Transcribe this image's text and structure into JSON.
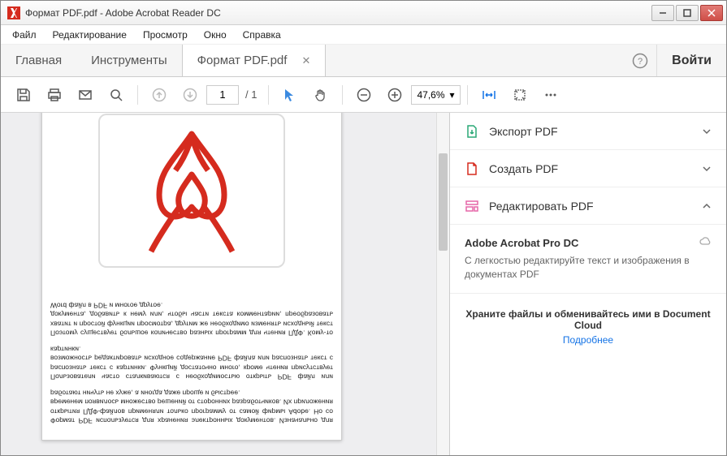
{
  "titlebar": {
    "title": "Формат PDF.pdf - Adobe Acrobat Reader DC"
  },
  "menu": {
    "file": "Файл",
    "edit": "Редактирование",
    "view": "Просмотр",
    "window": "Окно",
    "help": "Справка"
  },
  "tabs": {
    "home": "Главная",
    "tools": "Инструменты",
    "doc": "Формат PDF.pdf",
    "signin": "Войти"
  },
  "toolbar": {
    "page_current": "1",
    "page_total": "/ 1",
    "zoom": "47,6%"
  },
  "doc": {
    "para1": "Формат PDF используется для хранения электронных документов. Изначально для открытия ПДФ-файлов применяли только программу от самой фирмы Adobe. Но со временем появилось множество решений от сторонних разработчиков. Их приложения работают ничуть не хуже, а иногда даже проще и быстрее.",
    "para2": "Пользователи часто сталкиваются с необходимостью открыть PDF файл или распознать текст с картинки. Функций достаточно много, кроме чтения присутствует возможность редактировать исходное содержание PDF файла или распознать текст с картинки.",
    "para3": "Поэтому существует большое количество разных программ для чтения ПДФ. Кому-то хватит и простой функции просмотра, другим же необходимо изменять исходный текст документа, добавить к нему или, чтобы части текста комментарии, преобразовать Word файл в PDF и многое другое."
  },
  "rightpanel": {
    "export": "Экспорт PDF",
    "create": "Создать PDF",
    "edit": "Редактировать PDF",
    "promo_title": "Adobe Acrobat Pro DC",
    "promo_text": "С легкостью редактируйте текст и изображения в документах PDF",
    "cloud_title": "Храните файлы и обменивайтесь ими в Document Cloud",
    "cloud_link": "Подробнее"
  }
}
